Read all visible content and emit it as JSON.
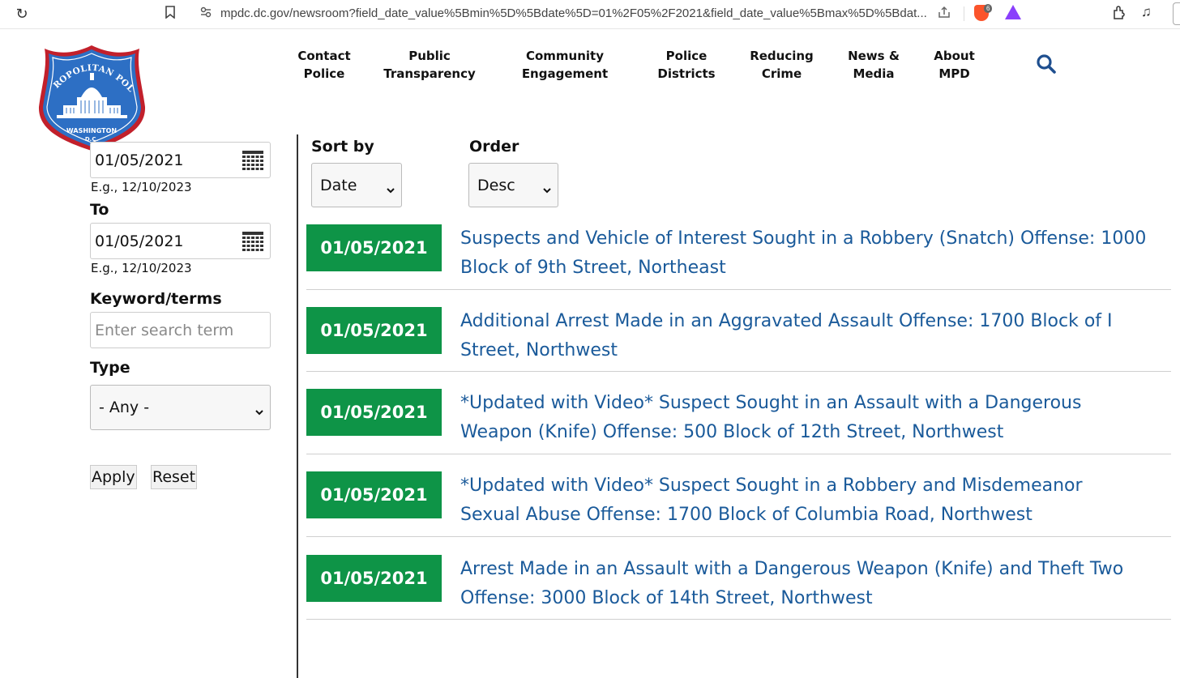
{
  "browser": {
    "url": "mpdc.dc.gov/newsroom?field_date_value%5Bmin%5D%5Bdate%5D=01%2F05%2F2021&field_date_value%5Bmax%5D%5Bdat...",
    "extension_count": "6",
    "icons": [
      "reload-icon",
      "bookmark-icon",
      "site-info-icon",
      "share-icon",
      "brave-icon",
      "triangle-icon",
      "extensions-icon",
      "media-icon"
    ]
  },
  "logo": {
    "top_text": "METROPOLITAN POLICE",
    "bottom_text": "WASHINGTON",
    "bottom_text2": "D.C.",
    "colors": {
      "blue": "#2d6fc4",
      "red": "#c2202b"
    }
  },
  "nav": {
    "items": [
      {
        "line1": "Contact",
        "line2": "Police"
      },
      {
        "line1": "Public",
        "line2": "Transparency"
      },
      {
        "line1": "Community",
        "line2": "Engagement"
      },
      {
        "line1": "Police",
        "line2": "Districts"
      },
      {
        "line1": "Reducing",
        "line2": "Crime"
      },
      {
        "line1": "News &",
        "line2": "Media"
      },
      {
        "line1": "About",
        "line2": "MPD"
      }
    ],
    "search_icon": "search-icon",
    "search_color": "#1f4f8f"
  },
  "filters": {
    "from_value": "01/05/2021",
    "from_hint": "E.g., 12/10/2023",
    "to_label": "To",
    "to_value": "01/05/2021",
    "to_hint": "E.g., 12/10/2023",
    "keyword_label": "Keyword/terms",
    "keyword_placeholder": "Enter search term",
    "type_label": "Type",
    "type_value": "- Any -",
    "apply_label": "Apply",
    "reset_label": "Reset"
  },
  "sort": {
    "sort_label": "Sort by",
    "sort_value": "Date",
    "order_label": "Order",
    "order_value": "Desc"
  },
  "results": [
    {
      "date": "01/05/2021",
      "line1": "Suspects and Vehicle of Interest Sought in a Robbery (Snatch) Offense: 1000",
      "line2": "Block of 9th Street, Northeast"
    },
    {
      "date": "01/05/2021",
      "line1": "Additional Arrest Made in an Aggravated Assault Offense: 1700 Block of I",
      "line2": "Street, Northwest"
    },
    {
      "date": "01/05/2021",
      "line1": "*Updated with Video* Suspect Sought in an Assault with a Dangerous",
      "line2": "Weapon (Knife) Offense: 500 Block of 12th Street, Northwest"
    },
    {
      "date": "01/05/2021",
      "line1": "*Updated with Video* Suspect Sought in a Robbery and Misdemeanor",
      "line2": "Sexual Abuse Offense: 1700 Block of Columbia Road, Northwest"
    },
    {
      "date": "01/05/2021",
      "line1": "Arrest Made in an Assault with a Dangerous Weapon (Knife) and Theft Two",
      "line2": "Offense: 3000 Block of 14th Street, Northwest"
    }
  ],
  "colors": {
    "date_badge": "#0e9447",
    "link": "#1a5a9a"
  }
}
